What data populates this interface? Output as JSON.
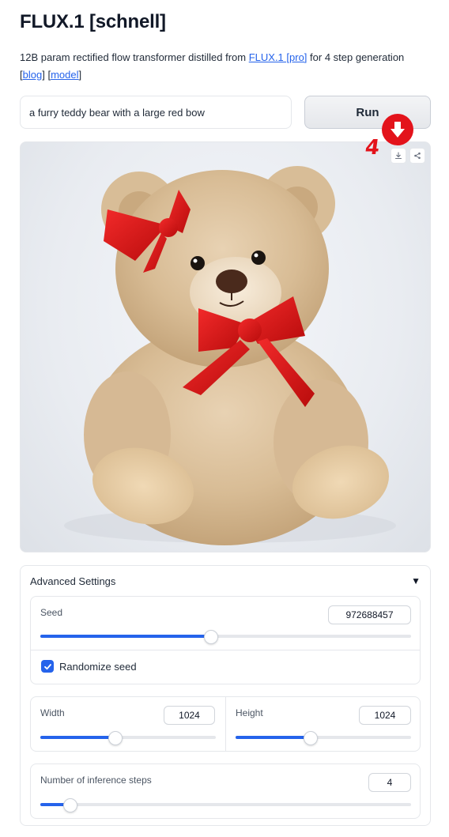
{
  "header": {
    "title": "FLUX.1 [schnell]",
    "desc_pre": "12B param rectified flow transformer distilled from ",
    "link_flux": "FLUX.1 [pro]",
    "desc_post": " for 4 step generation",
    "bracket_open_1": "[",
    "link_blog": "blog",
    "bracket_close_1": "]",
    "space": " ",
    "bracket_open_2": "[",
    "link_model": "model",
    "bracket_close_2": "]"
  },
  "prompt": {
    "value": "a furry teddy bear with a large red bow"
  },
  "run_button": {
    "label": "Run"
  },
  "result": {
    "download_icon": "download-icon",
    "share_icon": "share-icon"
  },
  "annotation": {
    "step_number": "4",
    "color": "#e3131b"
  },
  "advanced": {
    "title": "Advanced Settings",
    "toggle": "▼",
    "seed": {
      "label": "Seed",
      "value": "972688457",
      "fraction": 0.46
    },
    "randomize": {
      "label": "Randomize seed",
      "checked": true
    },
    "width": {
      "label": "Width",
      "value": "1024",
      "fraction": 0.43
    },
    "height": {
      "label": "Height",
      "value": "1024",
      "fraction": 0.43
    },
    "steps": {
      "label": "Number of inference steps",
      "value": "4",
      "fraction": 0.08
    }
  },
  "colors": {
    "accent": "#2563eb",
    "annotation": "#e3131b"
  }
}
